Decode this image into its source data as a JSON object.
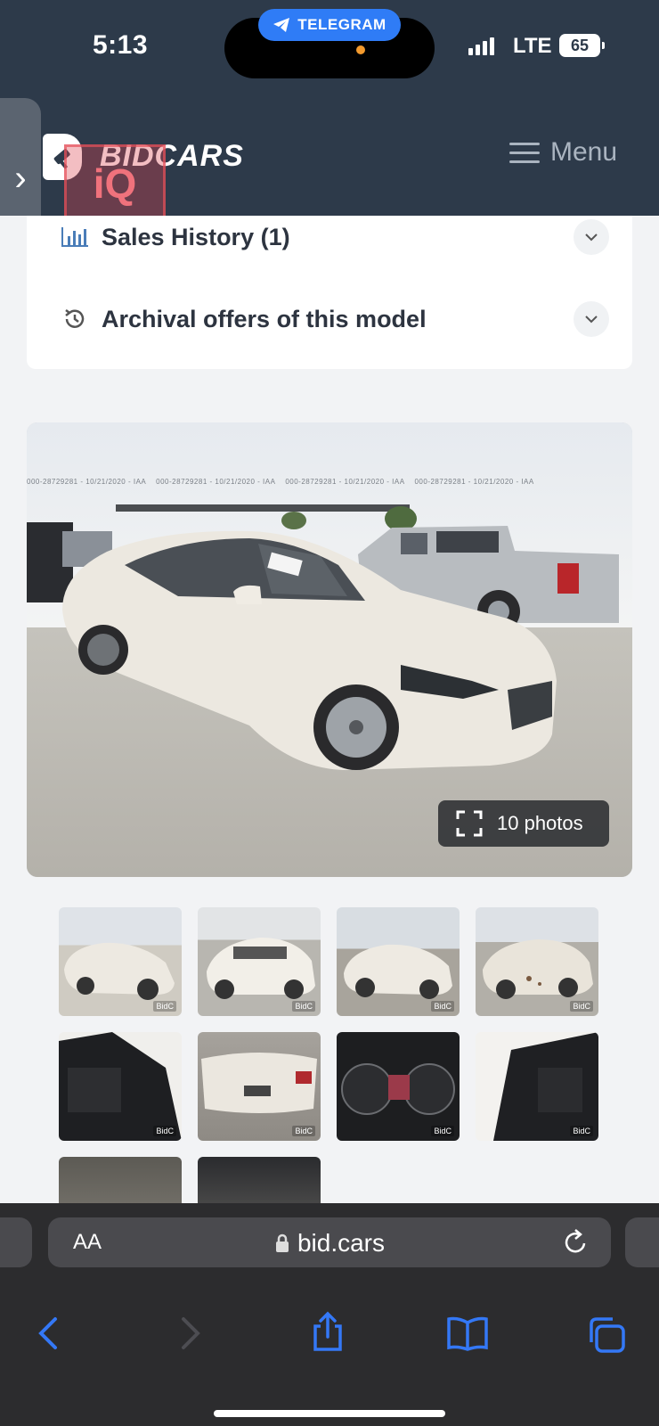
{
  "status_bar": {
    "time": "5:13",
    "telegram_label": "TELEGRAM",
    "network": "LTE",
    "battery": "65"
  },
  "header": {
    "logo": "BIDCARS",
    "menu_label": "Menu",
    "watermark": "iQ"
  },
  "accordion": [
    {
      "label": "Sales History (1)",
      "icon": "bar-chart-icon"
    },
    {
      "label": "Archival offers of this model",
      "icon": "history-icon"
    }
  ],
  "gallery": {
    "photos_label": "10 photos",
    "stamp": "000-28729281 - 10/21/2020 - IAA",
    "thumb_mark": "BidC",
    "thumbnails": [
      {
        "desc": "front-left"
      },
      {
        "desc": "front"
      },
      {
        "desc": "rear-left"
      },
      {
        "desc": "rear-right"
      },
      {
        "desc": "interior-front"
      },
      {
        "desc": "rear"
      },
      {
        "desc": "dashboard"
      },
      {
        "desc": "interior-rear"
      },
      {
        "desc": "underside"
      },
      {
        "desc": "engine"
      }
    ]
  },
  "browser": {
    "aa_label": "AA",
    "url": "bid.cars"
  },
  "colors": {
    "header_bg": "#2d3a4a",
    "accent_blue": "#2f7cf6",
    "ios_blue": "#3478f6"
  }
}
